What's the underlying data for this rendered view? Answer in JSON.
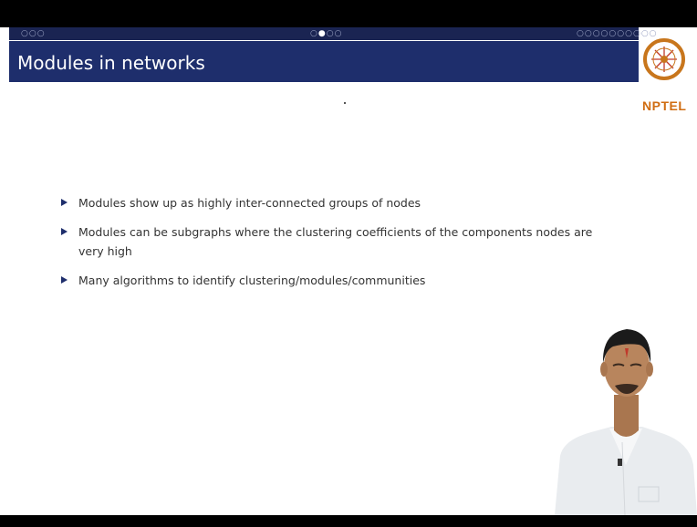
{
  "slide": {
    "title": "Modules in networks",
    "nav": {
      "left": "○○○",
      "middle_prefix": "○",
      "middle_current": "●",
      "middle_suffix": "○○",
      "right": "○○○○○○○○○○"
    },
    "bullets": [
      {
        "text": "Modules show up as highly inter-connected groups of nodes"
      },
      {
        "text": "Modules can be subgraphs where the clustering coefficients of the components nodes are very high"
      },
      {
        "text": "Many algorithms to identify clustering/modules/communities"
      }
    ]
  },
  "logo": {
    "text": "NPTEL",
    "color": "#d06d12"
  },
  "colors": {
    "title_bar": "#1e2e6c",
    "nav_strip": "#1a2452",
    "bullet_marker": "#1e2e6c"
  }
}
